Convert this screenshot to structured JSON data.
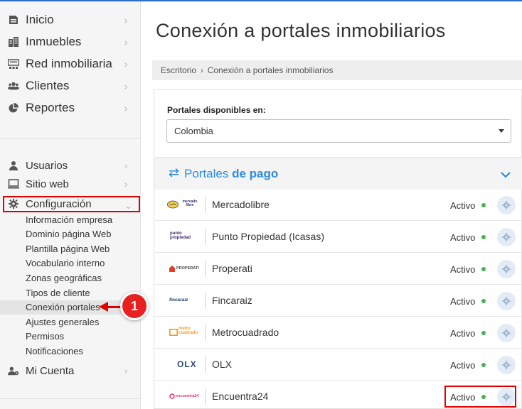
{
  "sidebar": {
    "main_items": [
      {
        "label": "Inicio",
        "icon": "file-icon"
      },
      {
        "label": "Inmuebles",
        "icon": "building-icon"
      },
      {
        "label": "Red inmobiliaria",
        "icon": "network-icon"
      },
      {
        "label": "Clientes",
        "icon": "users-icon"
      },
      {
        "label": "Reportes",
        "icon": "pie-chart-icon"
      }
    ],
    "admin_items": [
      {
        "label": "Usuarios",
        "icon": "user-icon"
      },
      {
        "label": "Sitio web",
        "icon": "monitor-icon"
      },
      {
        "label": "Configuración",
        "icon": "gear-icon"
      }
    ],
    "config_subitems": [
      "Información empresa",
      "Dominio página Web",
      "Plantilla página Web",
      "Vocabulario interno",
      "Zonas geográficas",
      "Tipos de cliente",
      "Conexión portales",
      "Ajustes generales",
      "Permisos",
      "Notificaciones"
    ],
    "account_item": {
      "label": "Mi Cuenta",
      "icon": "user-gear-icon"
    },
    "active_subitem": "Conexión portales"
  },
  "annotation": {
    "number": "1"
  },
  "page": {
    "title": "Conexión a portales inmobiliarios",
    "breadcrumb": [
      "Escritorio",
      "Conexión a portales inmobiliarios"
    ]
  },
  "filter": {
    "label": "Portales disponibles en:",
    "selected": "Colombia"
  },
  "section": {
    "title_prefix": "Portales ",
    "title_bold": "de pago"
  },
  "portals": [
    {
      "name": "Mercadolibre",
      "status": "Activo",
      "logo_text": "mercado libre"
    },
    {
      "name": "Punto Propiedad (Icasas)",
      "status": "Activo",
      "logo_text": "punto propiedad"
    },
    {
      "name": "Properati",
      "status": "Activo",
      "logo_text": "PROPERATI"
    },
    {
      "name": "Fincaraiz",
      "status": "Activo",
      "logo_text": "fincaraiz"
    },
    {
      "name": "Metrocuadrado",
      "status": "Activo",
      "logo_text": "metro cuadrado"
    },
    {
      "name": "OLX",
      "status": "Activo",
      "logo_text": "OLX"
    },
    {
      "name": "Encuentra24",
      "status": "Activo",
      "logo_text": "encuentra24"
    }
  ],
  "colors": {
    "accent": "#2d8ce0",
    "status_dot": "#4caf50",
    "highlight": "#e00000"
  }
}
